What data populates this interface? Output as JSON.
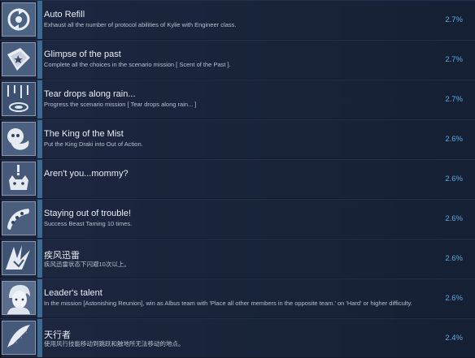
{
  "achievements": [
    {
      "title": "Auto Refill",
      "description": "Exhaust all the number of protocol abilities of Kylie with Engineer class.",
      "percent": "2.7%",
      "icon": "refill-icon"
    },
    {
      "title": "Glimpse of the past",
      "description": "Complete all the choices in the scenario mission [ Scent of the Past ].",
      "percent": "2.7%",
      "icon": "book-icon"
    },
    {
      "title": "Tear drops along rain...",
      "description": "Progress the scenario mission [ Tear drops along rain... ]",
      "percent": "2.7%",
      "icon": "rain-icon"
    },
    {
      "title": "The King of the Mist",
      "description": "Put the King Draki into Out of Action.",
      "percent": "2.6%",
      "icon": "draki-icon"
    },
    {
      "title": "Aren't you...mommy?",
      "description": "",
      "percent": "2.6%",
      "icon": "creature-icon"
    },
    {
      "title": "Staying out of trouble!",
      "description": "Success Beast Taming 10 times.",
      "percent": "2.6%",
      "icon": "bean-icon"
    },
    {
      "title": "疾风迅雷",
      "description": "疾风迅雷状态下闪避10次以上。",
      "percent": "2.6%",
      "icon": "lightning-icon"
    },
    {
      "title": "Leader's talent",
      "description": "In the mission [Astonishing Reunion], win as Albus team with 'Place all other members in the opposite team.' on 'Hard' or higher difficulty.",
      "percent": "2.6%",
      "icon": "leader-portrait-icon"
    },
    {
      "title": "天行者",
      "description": "使用风行技能移动到跳跃和触地所无法移动的地点。",
      "percent": "2.4%",
      "icon": "wing-icon"
    }
  ]
}
